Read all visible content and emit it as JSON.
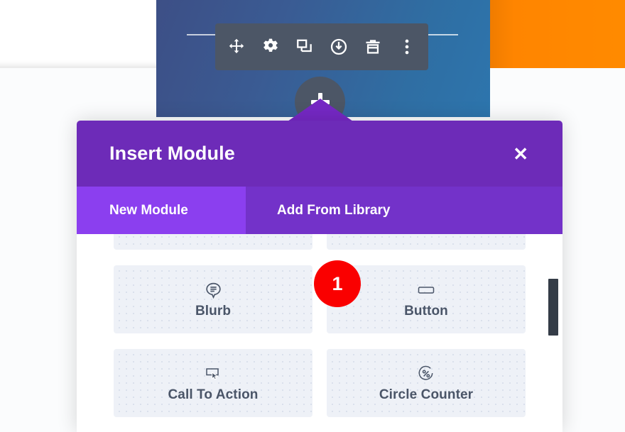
{
  "builder": {
    "toolbar": {
      "name": "module-settings-toolbar",
      "buttons": [
        {
          "icon": "move-icon",
          "label": "Move Module"
        },
        {
          "icon": "gear-icon",
          "label": "Module Settings"
        },
        {
          "icon": "duplicate-icon",
          "label": "Duplicate Module"
        },
        {
          "icon": "power-icon",
          "label": "Disable Module"
        },
        {
          "icon": "trash-icon",
          "label": "Delete Module"
        },
        {
          "icon": "more-vertical-icon",
          "label": "Other Options"
        }
      ]
    },
    "add_button": {
      "icon": "plus-icon",
      "label": "Add New Module"
    }
  },
  "modal": {
    "title": "Insert Module",
    "close_label": "✕",
    "close_icon": "close-icon",
    "tabs": [
      {
        "label": "New Module",
        "active": true
      },
      {
        "label": "Add From Library",
        "active": false
      }
    ],
    "modules": [
      {
        "label": "Blurb",
        "icon": "speech-bubble-lines-icon"
      },
      {
        "label": "Button",
        "icon": "rounded-rectangle-icon"
      },
      {
        "label": "Call To Action",
        "icon": "rectangle-cursor-icon"
      },
      {
        "label": "Circle Counter",
        "icon": "percent-circle-icon"
      }
    ],
    "scrollbar": {
      "name": "modules-scrollbar"
    }
  },
  "annotation": {
    "step_number": "1"
  },
  "colors": {
    "header_purple": "#6d2bb8",
    "tab_bar_purple": "#7332c9",
    "tab_active_purple": "#8b3fef",
    "toolbar_grey": "#4c5666",
    "card_bg": "#eef1f7",
    "badge_red": "#fa0000",
    "accent_orange": "#ff8500"
  }
}
